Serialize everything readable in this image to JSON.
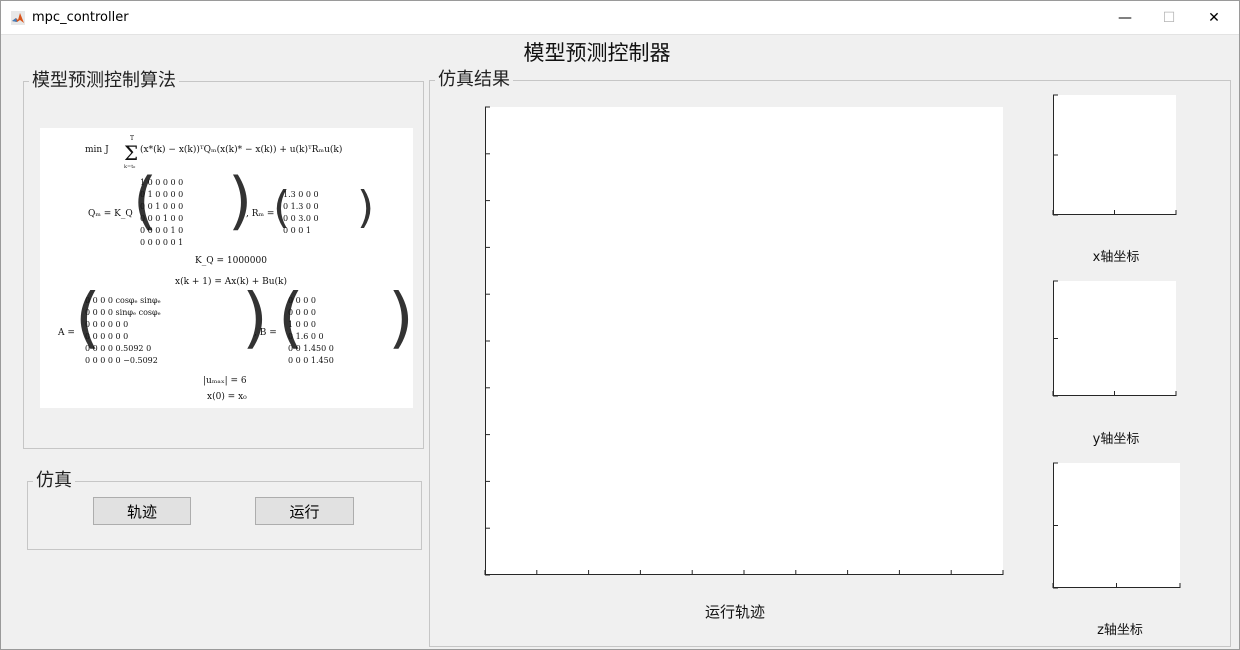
{
  "window": {
    "title": "mpc_controller",
    "minimize_glyph": "—",
    "maximize_glyph": "☐",
    "close_glyph": "✕"
  },
  "header": {
    "title": "模型预测控制器"
  },
  "algorithm_panel": {
    "label": "模型预测控制算法",
    "formula_image": "mpc-formula-image"
  },
  "simulation_panel": {
    "label": "仿真",
    "trajectory_button": "轨迹",
    "run_button": "运行"
  },
  "results_panel": {
    "label": "仿真结果",
    "main_axes_caption": "运行轨迹",
    "x_axes_caption": "x轴坐标",
    "y_axes_caption": "y轴坐标",
    "z_axes_caption": "z轴坐标"
  },
  "icons": {
    "app": "matlab-icon"
  }
}
